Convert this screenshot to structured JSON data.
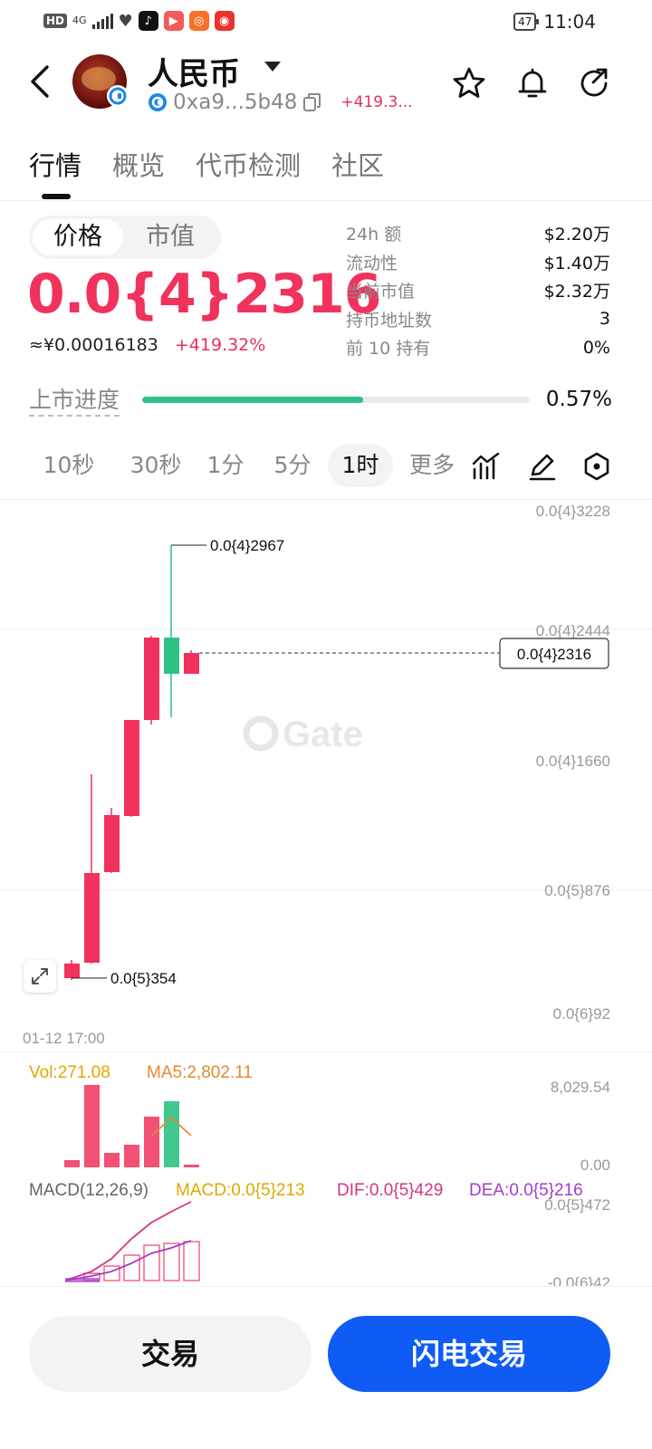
{
  "status_bar": {
    "hd": "HD",
    "network": "4G",
    "battery": "47",
    "time": "11:04"
  },
  "header": {
    "coin_name": "人民币",
    "address": "0xa9...5b48",
    "change": "+419.3..."
  },
  "tabs": [
    {
      "label": "行情",
      "active": true
    },
    {
      "label": "概览",
      "active": false
    },
    {
      "label": "代币检测",
      "active": false
    },
    {
      "label": "社区",
      "active": false
    }
  ],
  "price_toggle": {
    "price": "价格",
    "market_cap": "市值"
  },
  "price": {
    "value": "0.0{4}2316",
    "cny": "≈¥0.00016183",
    "change": "+419.32%"
  },
  "stats": [
    {
      "label": "24h 额",
      "value": "$2.20万"
    },
    {
      "label": "流动性",
      "value": "$1.40万"
    },
    {
      "label": "当前市值",
      "value": "$2.32万"
    },
    {
      "label": "持币地址数",
      "value": "3"
    },
    {
      "label": "前 10 持有",
      "value": "0%"
    }
  ],
  "listing": {
    "label": "上市进度",
    "value": "0.57%",
    "progress": 0.57
  },
  "intervals": [
    "10秒",
    "30秒",
    "1分",
    "5分",
    "1时",
    "更多"
  ],
  "active_interval": "1时",
  "chart": {
    "watermark": "Gate",
    "y_ticks": [
      "0.0{4}3228",
      "0.0{4}2444",
      "0.0{4}1660",
      "0.0{5}876",
      "0.0{6}92"
    ],
    "current_label": "0.0{4}2316",
    "high_label": "0.0{4}2967",
    "low_label": "0.0{5}354",
    "time_label": "01-12 17:00",
    "vol_label": "Vol:271.08",
    "ma5_label": "MA5:2,802.11",
    "vol_ticks": [
      "8,029.54",
      "0.00"
    ],
    "macd_label": "MACD(12,26,9)",
    "macd_value": "MACD:0.0{5}213",
    "dif_value": "DIF:0.0{5}429",
    "dea_value": "DEA:0.0{5}216",
    "macd_ticks": [
      "0.0{5}472",
      "-0.0{6}42"
    ]
  },
  "colors": {
    "up": "#f0325d",
    "down": "#2ec185",
    "primary": "#0e5cf3",
    "vol_label": "#e0a800",
    "ma5": "#e08a2e",
    "dif": "#d63384",
    "dea": "#a63cc9"
  },
  "buttons": {
    "trade": "交易",
    "flash_trade": "闪电交易"
  }
}
